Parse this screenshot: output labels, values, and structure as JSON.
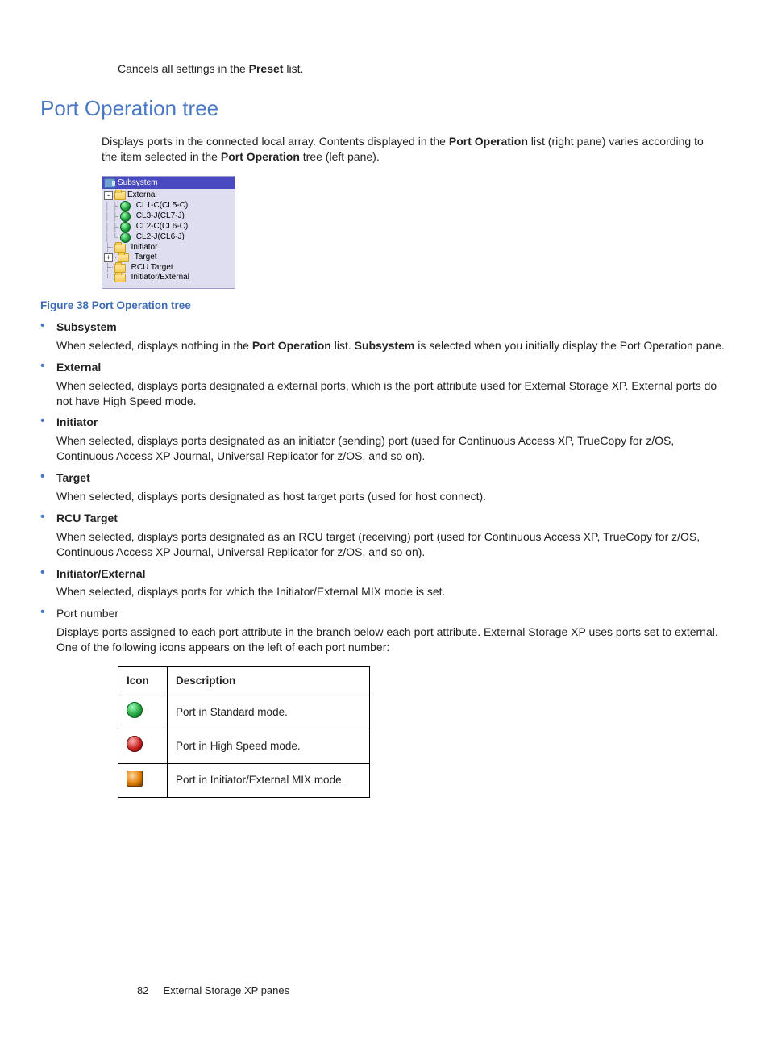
{
  "top_line": {
    "pre": "Cancels all settings in the ",
    "bold": "Preset",
    "post": " list."
  },
  "heading": "Port Operation tree",
  "intro": {
    "pre": "Displays ports in the connected local array. Contents displayed in the ",
    "b1": "Port Operation",
    "mid": " list (right pane) varies according to the item selected in the ",
    "b2": "Port Operation",
    "post": " tree (left pane)."
  },
  "tree": {
    "header": "Subsystem",
    "root": "External",
    "ports": [
      "CL1-C(CL5-C)",
      "CL3-J(CL7-J)",
      "CL2-C(CL6-C)",
      "CL2-J(CL6-J)"
    ],
    "leaves": [
      "Initiator",
      "Target",
      "RCU Target",
      "Initiator/External"
    ]
  },
  "figure_caption": "Figure 38 Port Operation tree",
  "items": [
    {
      "term": "Subsystem",
      "term_bold": true,
      "def_parts": [
        {
          "t": "When selected, displays nothing in the "
        },
        {
          "t": "Port Operation",
          "b": true
        },
        {
          "t": " list. "
        },
        {
          "t": "Subsystem",
          "b": true
        },
        {
          "t": " is selected when you initially display the Port Operation pane."
        }
      ]
    },
    {
      "term": "External",
      "term_bold": true,
      "def_parts": [
        {
          "t": "When selected, displays ports designated a external ports, which is the port attribute used for External Storage XP. External ports do not have High Speed mode."
        }
      ]
    },
    {
      "term": "Initiator",
      "term_bold": true,
      "def_parts": [
        {
          "t": "When selected, displays ports designated as an initiator (sending) port (used for Continuous Access XP, TrueCopy for z/OS, Continuous Access XP Journal, Universal Replicator for z/OS, and so on)."
        }
      ]
    },
    {
      "term": "Target",
      "term_bold": true,
      "def_parts": [
        {
          "t": "When selected, displays ports designated as host target ports (used for host connect)."
        }
      ]
    },
    {
      "term": "RCU Target",
      "term_bold": true,
      "def_parts": [
        {
          "t": "When selected, displays ports designated as an RCU target (receiving) port (used for Continuous Access XP, TrueCopy for z/OS, Continuous Access XP Journal, Universal Replicator for z/OS, and so on)."
        }
      ]
    },
    {
      "term": "Initiator/External",
      "term_bold": true,
      "def_parts": [
        {
          "t": "When selected, displays ports for which the Initiator/External MIX mode is set."
        }
      ]
    },
    {
      "term": "Port number",
      "term_bold": false,
      "def_parts": [
        {
          "t": "Displays ports assigned to each port attribute in the branch below each port attribute. External Storage XP uses ports set to external. One of the following icons appears on the left of each port number:"
        }
      ]
    }
  ],
  "table": {
    "h1": "Icon",
    "h2": "Description",
    "rows": [
      {
        "icon": "std",
        "desc": "Port in Standard mode."
      },
      {
        "icon": "hs",
        "desc": "Port in High Speed mode."
      },
      {
        "icon": "mix",
        "desc": "Port in Initiator/External MIX mode."
      }
    ]
  },
  "footer": {
    "page": "82",
    "title": "External Storage XP panes"
  }
}
